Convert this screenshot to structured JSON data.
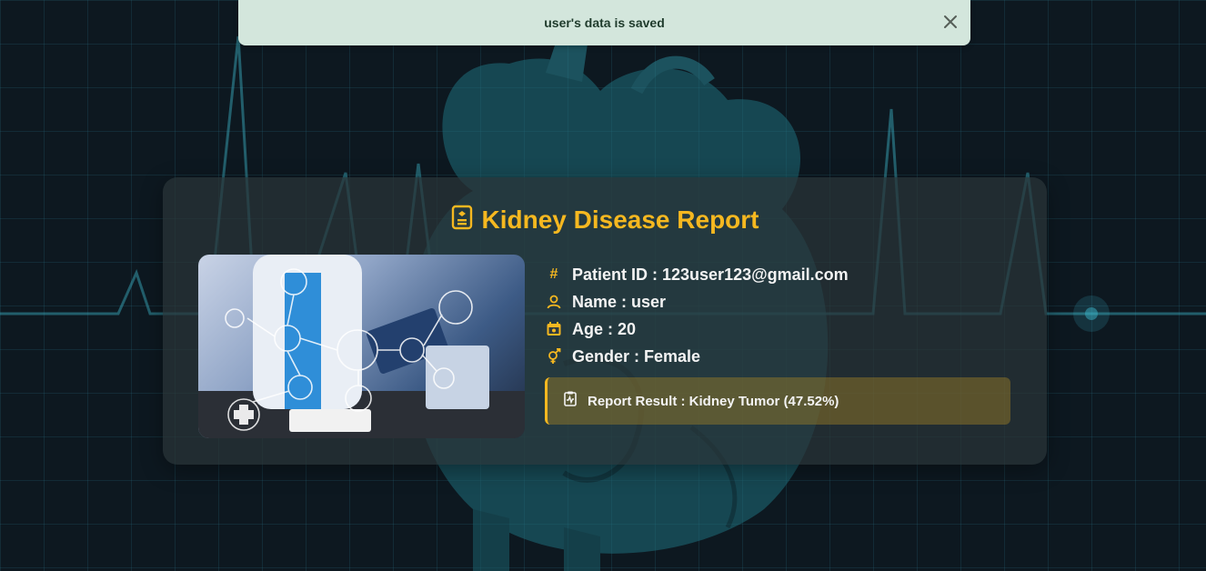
{
  "toast": {
    "message": "user's data is saved",
    "close_icon": "close-icon",
    "background": "#d3e6dc"
  },
  "report": {
    "title": "Kidney Disease Report",
    "title_icon": "clipboard-id-icon",
    "accent_color": "#f6b820",
    "image_alt": "doctor using tablet with medical icons",
    "fields": [
      {
        "icon": "hash-icon",
        "text": "Patient ID : 123user123@gmail.com"
      },
      {
        "icon": "user-icon",
        "text": "Name : user"
      },
      {
        "icon": "calendar-icon",
        "text": "Age : 20"
      },
      {
        "icon": "gender-icon",
        "text": "Gender : Female"
      }
    ],
    "result": {
      "icon": "clipboard-pulse-icon",
      "text": "Report Result : Kidney Tumor (47.52%)"
    }
  }
}
